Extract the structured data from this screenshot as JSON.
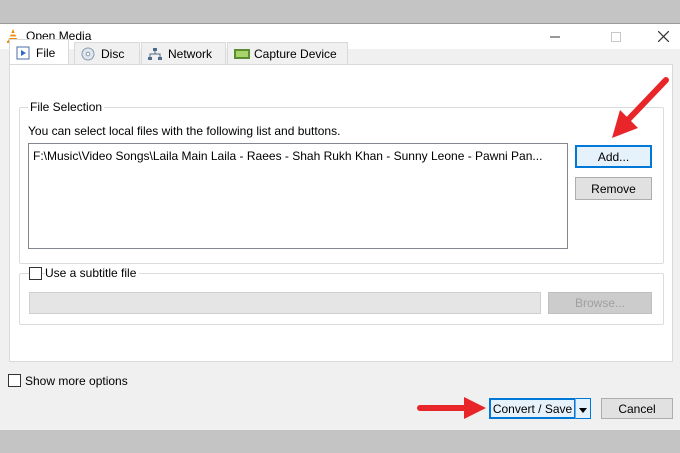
{
  "window": {
    "title": "Open Media"
  },
  "tabs": [
    {
      "label": "File",
      "icon": "file-play-icon"
    },
    {
      "label": "Disc",
      "icon": "disc-icon"
    },
    {
      "label": "Network",
      "icon": "network-icon"
    },
    {
      "label": "Capture Device",
      "icon": "capture-device-icon"
    }
  ],
  "file_selection": {
    "legend": "File Selection",
    "hint": "You can select local files with the following list and buttons.",
    "files": [
      "F:\\Music\\Video Songs\\Laila Main Laila - Raees - Shah Rukh Khan - Sunny Leone - Pawni Pan..."
    ],
    "add_label": "Add...",
    "remove_label": "Remove"
  },
  "subtitle": {
    "checkbox_label": "Use a subtitle file",
    "input_value": "",
    "browse_label": "Browse..."
  },
  "footer": {
    "more_options_label": "Show more options",
    "convert_label": "Convert / Save",
    "cancel_label": "Cancel"
  },
  "colors": {
    "accent": "#0078d7",
    "annotation_arrow": "#e8262a"
  }
}
